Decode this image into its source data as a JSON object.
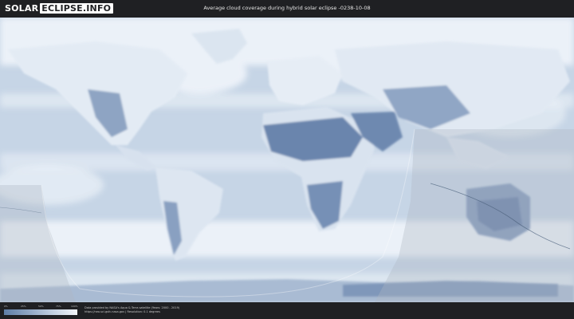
{
  "header": {
    "logo_left": "SOLAR",
    "logo_right": "ECLIPSE.INFO",
    "title": "Average cloud coverage during hybrid solar eclipse -0238-10-08"
  },
  "legend": {
    "ticks": [
      "0%",
      "25%",
      "50%",
      "75%",
      "100%"
    ],
    "colors": [
      "#5f7fa7",
      "#8ea5c3",
      "#c2d0e1",
      "#f2f5f9"
    ]
  },
  "credits": {
    "line1": "Data provided by NASA's Aqua & Terra satellite (Years: 2000 - 2019)",
    "line2": "https://neo.sci.gsfc.nasa.gov | Resolution: 0.1 degrees"
  },
  "map": {
    "ocean_color": "#c9d7e7",
    "dense_cloud_color": "#f1f5fa",
    "clear_land_color": "#6b86ae",
    "night_overlay_color": "#b8c1cc",
    "eclipse_path_color": "#4a5f7a"
  }
}
